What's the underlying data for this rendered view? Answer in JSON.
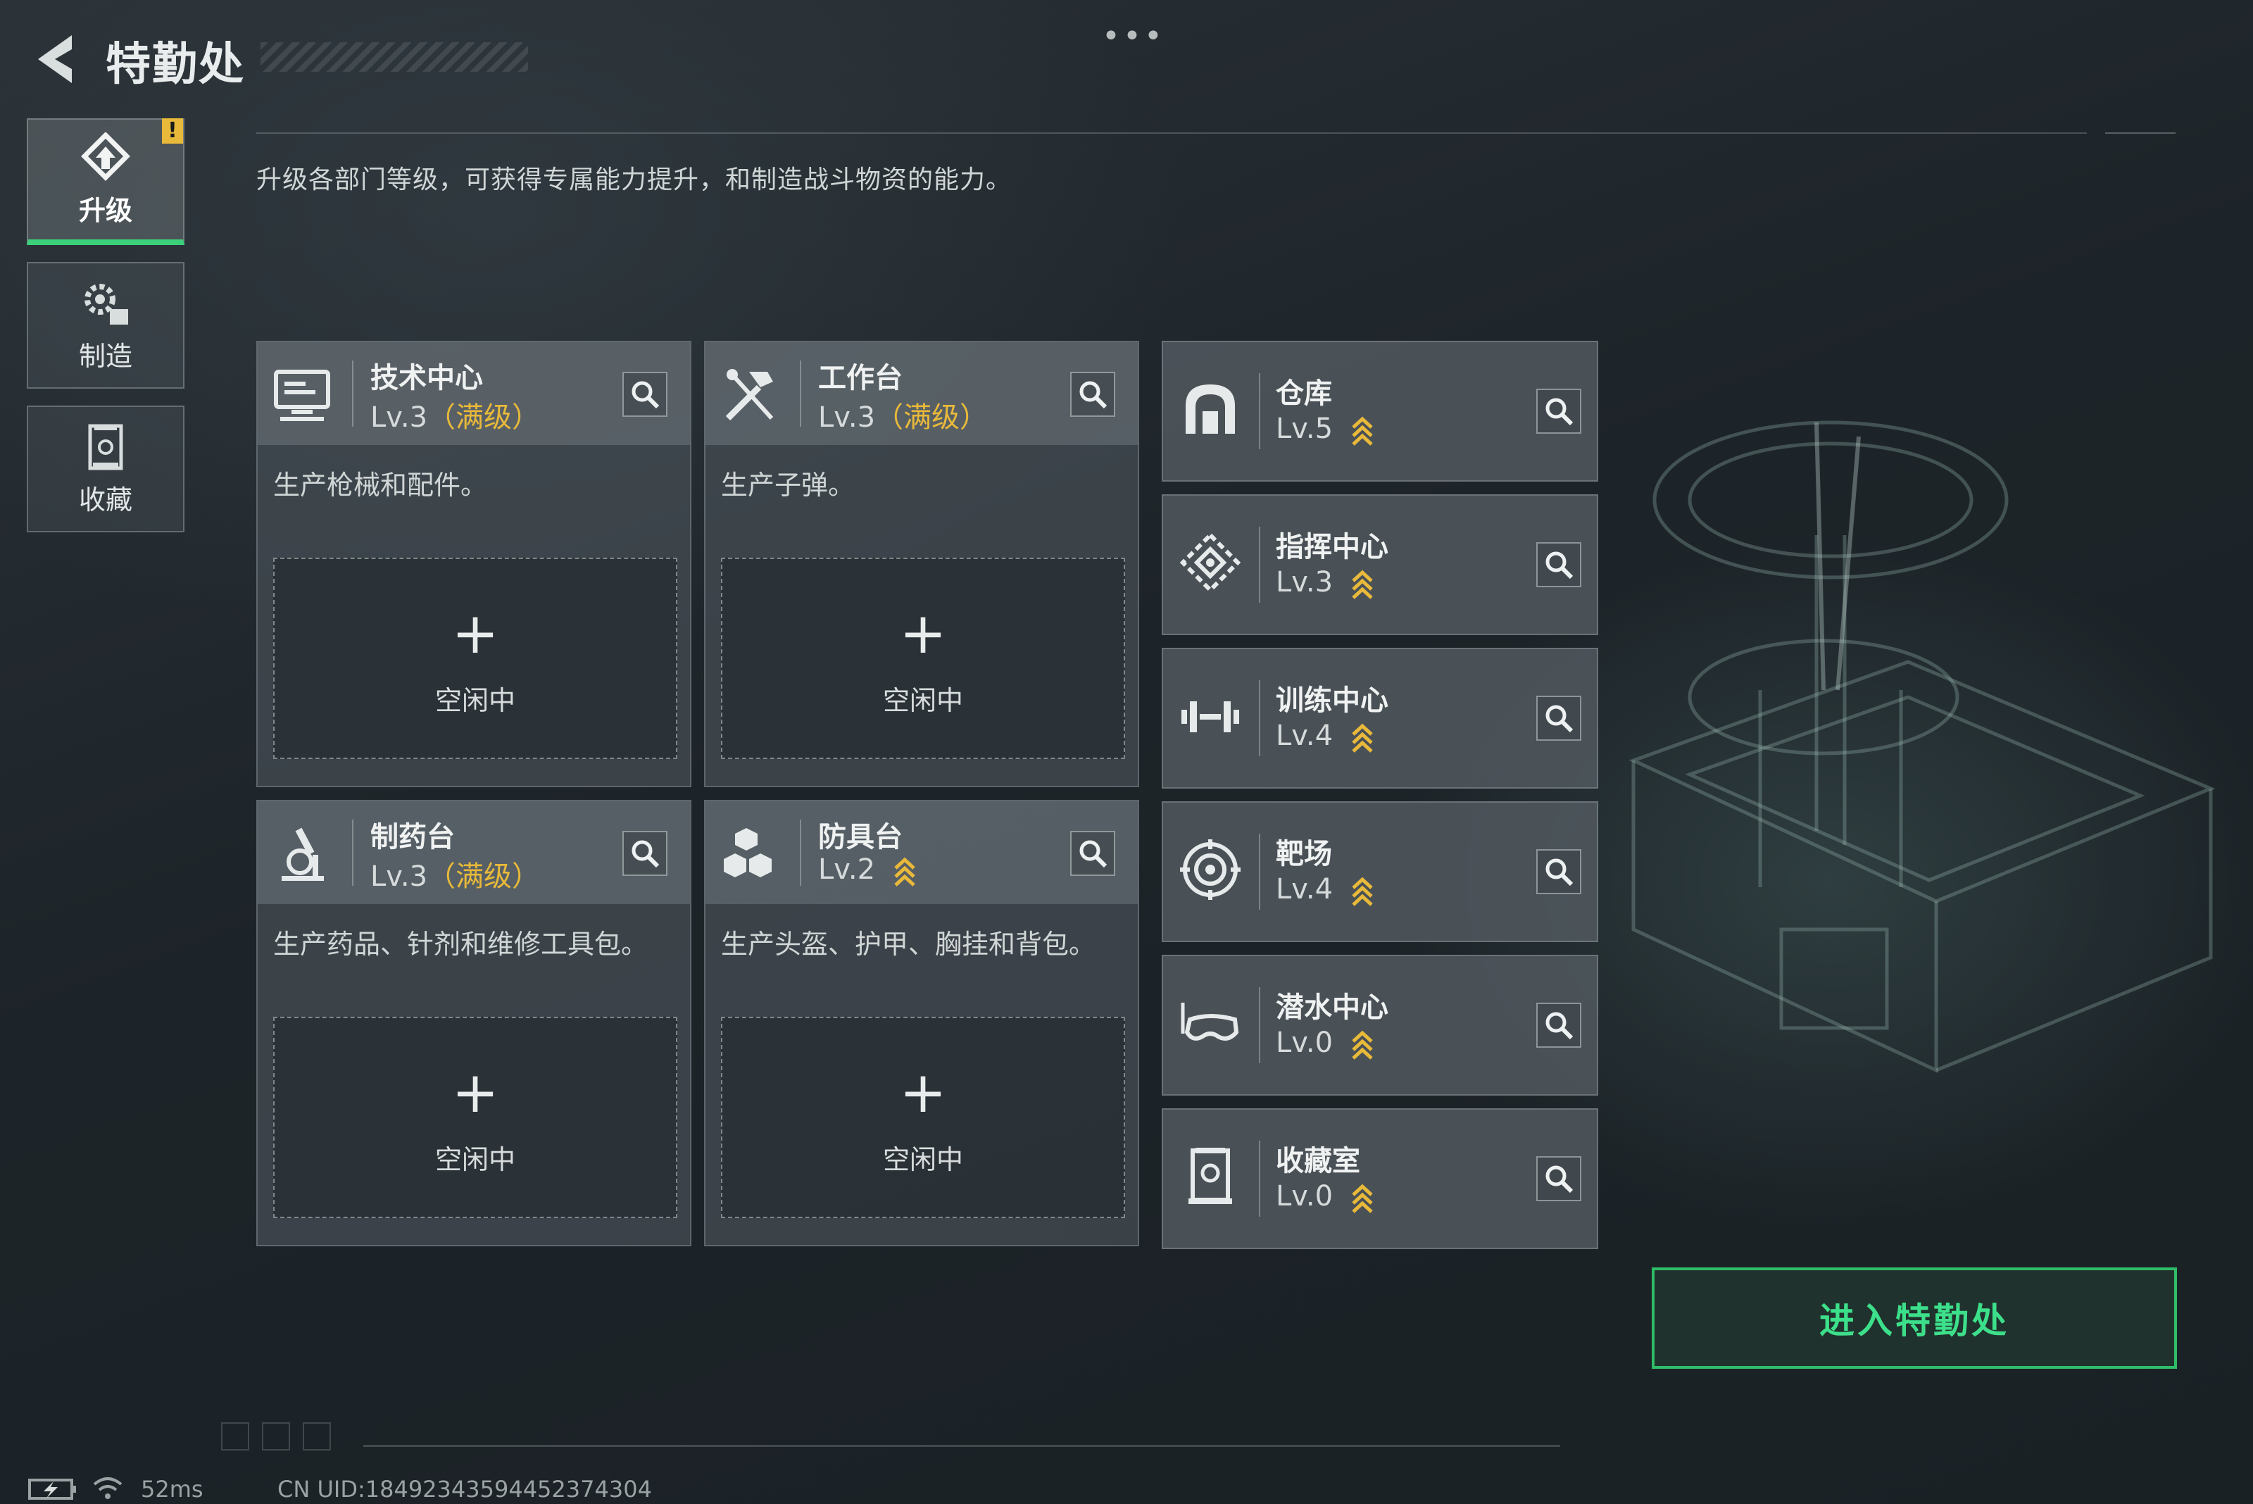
{
  "header": {
    "back_icon": "back-arrow-icon",
    "title": "特勤处",
    "more_icon": "more-dots-icon",
    "more_label": "•••",
    "description": "升级各部门等级，可获得专属能力提升，和制造战斗物资的能力。"
  },
  "sidebar": {
    "items": [
      {
        "label": "升级",
        "icon": "upgrade-icon",
        "active": true,
        "badge": "!"
      },
      {
        "label": "制造",
        "icon": "gears-icon",
        "active": false
      },
      {
        "label": "收藏",
        "icon": "collection-icon",
        "active": false
      }
    ]
  },
  "cards": [
    {
      "name": "技术中心",
      "level": "Lv.3",
      "max": "（满级）",
      "description": "生产枪械和配件。",
      "slot_plus": "+",
      "slot_status": "空闲中",
      "icon": "computer-icon"
    },
    {
      "name": "工作台",
      "level": "Lv.3",
      "max": "（满级）",
      "description": "生产子弹。",
      "slot_plus": "+",
      "slot_status": "空闲中",
      "icon": "tools-icon"
    },
    {
      "name": "制药台",
      "level": "Lv.3",
      "max": "（满级）",
      "description": "生产药品、针剂和维修工具包。",
      "slot_plus": "+",
      "slot_status": "空闲中",
      "icon": "microscope-icon"
    },
    {
      "name": "防具台",
      "level": "Lv.2",
      "max": "",
      "description": "生产头盔、护甲、胸挂和背包。",
      "slot_plus": "+",
      "slot_status": "空闲中",
      "icon": "armor-boxes-icon"
    }
  ],
  "facilities": [
    {
      "name": "仓库",
      "level": "Lv.5",
      "icon": "warehouse-icon"
    },
    {
      "name": "指挥中心",
      "level": "Lv.3",
      "icon": "command-center-icon"
    },
    {
      "name": "训练中心",
      "level": "Lv.4",
      "icon": "dumbbell-icon"
    },
    {
      "name": "靶场",
      "level": "Lv.4",
      "icon": "target-icon"
    },
    {
      "name": "潜水中心",
      "level": "Lv.0",
      "icon": "diving-mask-icon"
    },
    {
      "name": "收藏室",
      "level": "Lv.0",
      "icon": "collection-room-icon"
    }
  ],
  "enter_button": {
    "label": "进入特勤处"
  },
  "status_bar": {
    "ping": "52ms",
    "uid": "CN UID:18492343594452374304"
  },
  "colors": {
    "accent_green": "#3de08a",
    "max_gold": "#e8b93a",
    "badge_yellow": "#e8b93a"
  }
}
